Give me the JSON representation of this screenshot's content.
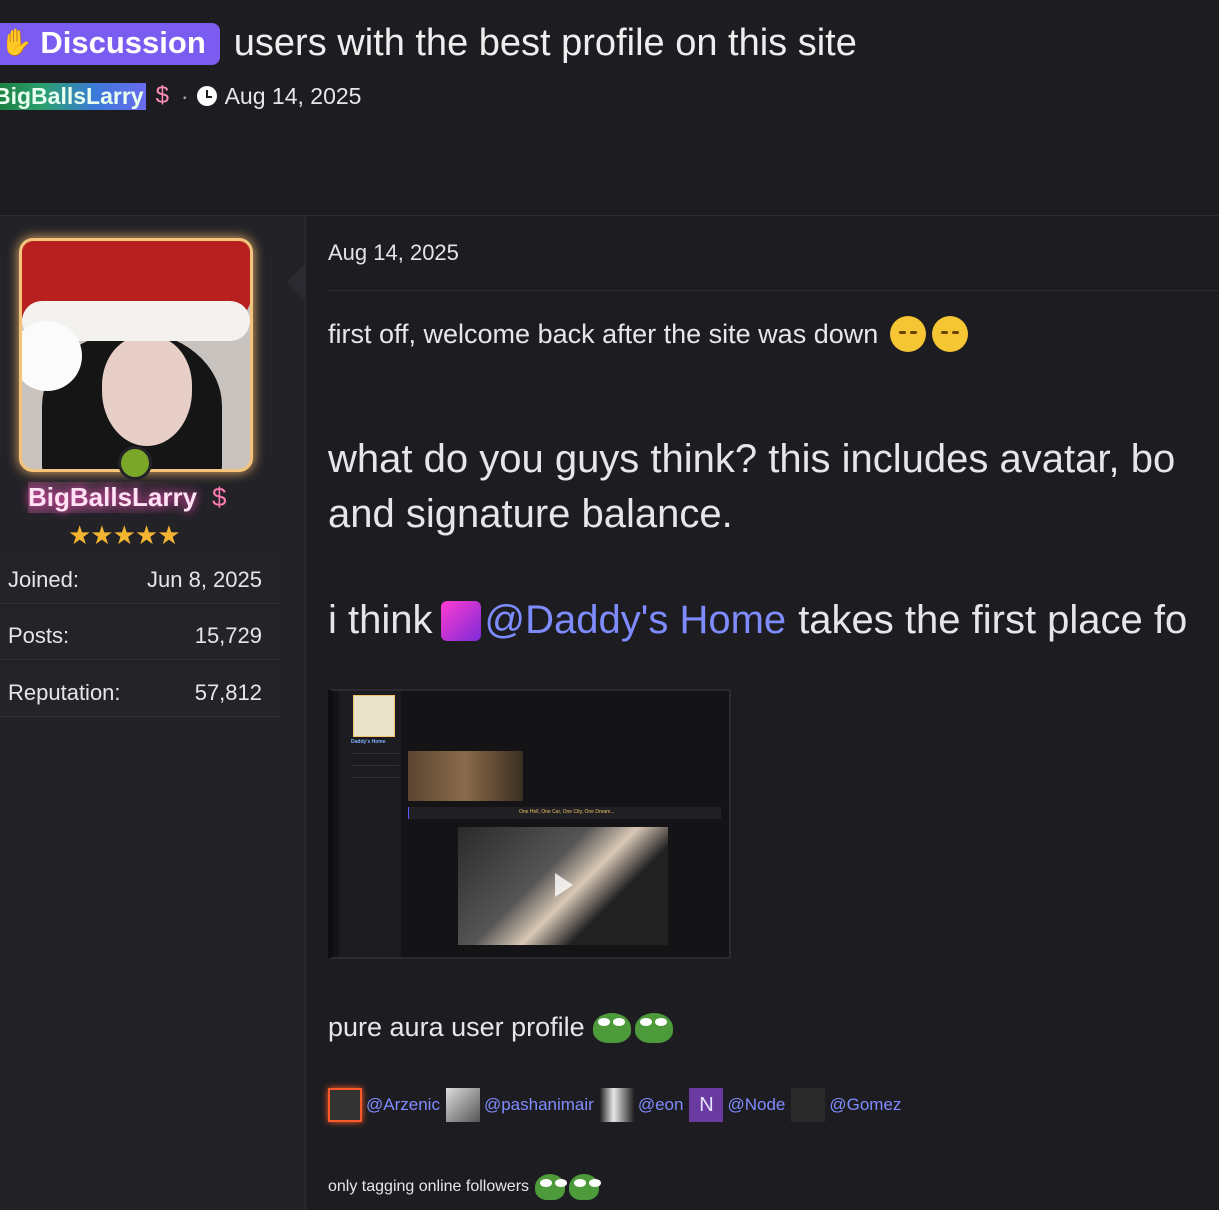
{
  "thread": {
    "prefix": "Discussion",
    "title": "users with the best profile on this site",
    "author": "BigBallsLarry",
    "date": "Aug 14, 2025"
  },
  "author_card": {
    "username": "BigBallsLarry",
    "stars": "★★★★★",
    "rating": 5,
    "stats": [
      {
        "label": "Joined:",
        "value": "Jun 8, 2025"
      },
      {
        "label": "Posts:",
        "value": "15,729"
      },
      {
        "label": "Reputation:",
        "value": "57,812"
      }
    ]
  },
  "post": {
    "date": "Aug 14, 2025",
    "line1": "first off, welcome back after the site was down",
    "big1": "what do you guys think? this includes avatar, bo",
    "big1b": "and signature balance.",
    "big2_prefix": "i think",
    "big2_mention": "@Daddy's Home",
    "big2_suffix": "takes the first place fo",
    "pure": "pure aura user profile",
    "tags": [
      "@Arzenic",
      "@pashanimair",
      "@eon",
      "@Node",
      "@Gomez"
    ],
    "node_letter": "N",
    "only": "only tagging online followers"
  },
  "screenshot_preview": {
    "name": "Daddy's Home",
    "banner": "One Hell, One Car, One City, One Dream..."
  },
  "icons": {
    "prefix": "hand-icon",
    "dollar": "dollar-icon",
    "clock": "clock-icon"
  },
  "colors": {
    "accent": "#7a5cf0",
    "mention": "#7f8cff",
    "online": "#7aa62a",
    "star": "#f3b531"
  }
}
